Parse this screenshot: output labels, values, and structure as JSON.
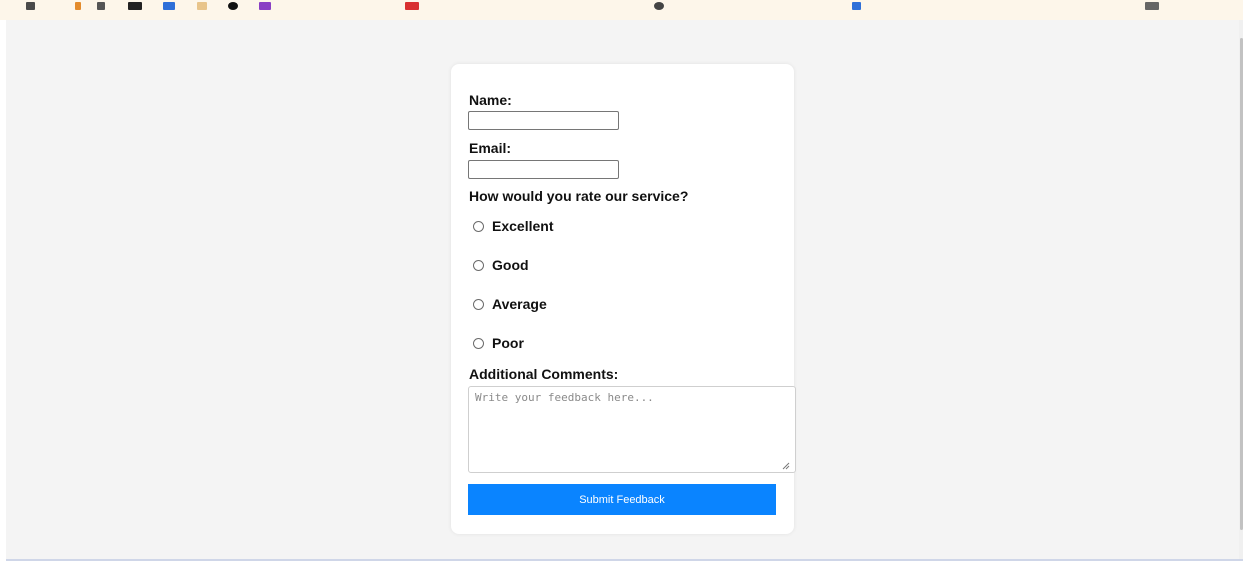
{
  "form": {
    "name_label": "Name:",
    "name_value": "",
    "email_label": "Email:",
    "email_value": "",
    "rating_question": "How would you rate our service?",
    "rating_options": [
      "Excellent",
      "Good",
      "Average",
      "Poor"
    ],
    "rating_selected": null,
    "comments_label": "Additional Comments:",
    "comments_placeholder": "Write your feedback here...",
    "comments_value": "",
    "submit_label": "Submit Feedback"
  },
  "colors": {
    "page_background": "#f4f4f4",
    "card_background": "#ffffff",
    "submit_button": "#0a84ff",
    "bookmark_bar": "#fdf6ea"
  }
}
